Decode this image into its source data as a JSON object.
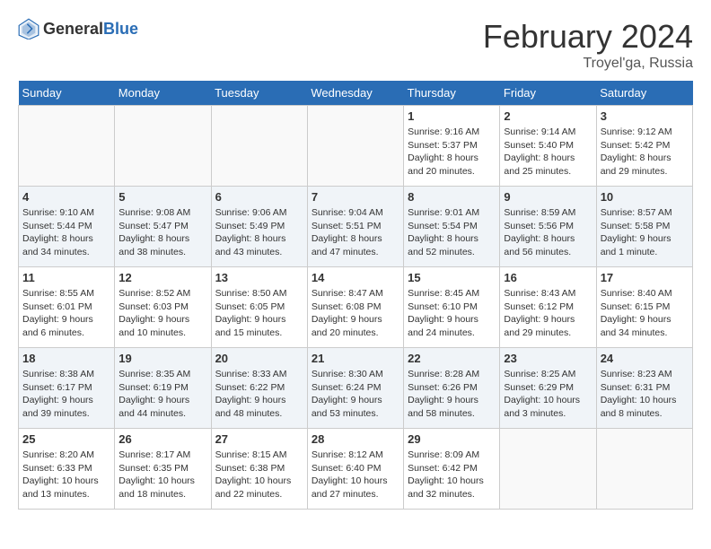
{
  "header": {
    "logo_general": "General",
    "logo_blue": "Blue",
    "month_year": "February 2024",
    "location": "Troyel'ga, Russia"
  },
  "weekdays": [
    "Sunday",
    "Monday",
    "Tuesday",
    "Wednesday",
    "Thursday",
    "Friday",
    "Saturday"
  ],
  "weeks": [
    {
      "shaded": false,
      "days": [
        {
          "num": "",
          "info": ""
        },
        {
          "num": "",
          "info": ""
        },
        {
          "num": "",
          "info": ""
        },
        {
          "num": "",
          "info": ""
        },
        {
          "num": "1",
          "info": "Sunrise: 9:16 AM\nSunset: 5:37 PM\nDaylight: 8 hours\nand 20 minutes."
        },
        {
          "num": "2",
          "info": "Sunrise: 9:14 AM\nSunset: 5:40 PM\nDaylight: 8 hours\nand 25 minutes."
        },
        {
          "num": "3",
          "info": "Sunrise: 9:12 AM\nSunset: 5:42 PM\nDaylight: 8 hours\nand 29 minutes."
        }
      ]
    },
    {
      "shaded": true,
      "days": [
        {
          "num": "4",
          "info": "Sunrise: 9:10 AM\nSunset: 5:44 PM\nDaylight: 8 hours\nand 34 minutes."
        },
        {
          "num": "5",
          "info": "Sunrise: 9:08 AM\nSunset: 5:47 PM\nDaylight: 8 hours\nand 38 minutes."
        },
        {
          "num": "6",
          "info": "Sunrise: 9:06 AM\nSunset: 5:49 PM\nDaylight: 8 hours\nand 43 minutes."
        },
        {
          "num": "7",
          "info": "Sunrise: 9:04 AM\nSunset: 5:51 PM\nDaylight: 8 hours\nand 47 minutes."
        },
        {
          "num": "8",
          "info": "Sunrise: 9:01 AM\nSunset: 5:54 PM\nDaylight: 8 hours\nand 52 minutes."
        },
        {
          "num": "9",
          "info": "Sunrise: 8:59 AM\nSunset: 5:56 PM\nDaylight: 8 hours\nand 56 minutes."
        },
        {
          "num": "10",
          "info": "Sunrise: 8:57 AM\nSunset: 5:58 PM\nDaylight: 9 hours\nand 1 minute."
        }
      ]
    },
    {
      "shaded": false,
      "days": [
        {
          "num": "11",
          "info": "Sunrise: 8:55 AM\nSunset: 6:01 PM\nDaylight: 9 hours\nand 6 minutes."
        },
        {
          "num": "12",
          "info": "Sunrise: 8:52 AM\nSunset: 6:03 PM\nDaylight: 9 hours\nand 10 minutes."
        },
        {
          "num": "13",
          "info": "Sunrise: 8:50 AM\nSunset: 6:05 PM\nDaylight: 9 hours\nand 15 minutes."
        },
        {
          "num": "14",
          "info": "Sunrise: 8:47 AM\nSunset: 6:08 PM\nDaylight: 9 hours\nand 20 minutes."
        },
        {
          "num": "15",
          "info": "Sunrise: 8:45 AM\nSunset: 6:10 PM\nDaylight: 9 hours\nand 24 minutes."
        },
        {
          "num": "16",
          "info": "Sunrise: 8:43 AM\nSunset: 6:12 PM\nDaylight: 9 hours\nand 29 minutes."
        },
        {
          "num": "17",
          "info": "Sunrise: 8:40 AM\nSunset: 6:15 PM\nDaylight: 9 hours\nand 34 minutes."
        }
      ]
    },
    {
      "shaded": true,
      "days": [
        {
          "num": "18",
          "info": "Sunrise: 8:38 AM\nSunset: 6:17 PM\nDaylight: 9 hours\nand 39 minutes."
        },
        {
          "num": "19",
          "info": "Sunrise: 8:35 AM\nSunset: 6:19 PM\nDaylight: 9 hours\nand 44 minutes."
        },
        {
          "num": "20",
          "info": "Sunrise: 8:33 AM\nSunset: 6:22 PM\nDaylight: 9 hours\nand 48 minutes."
        },
        {
          "num": "21",
          "info": "Sunrise: 8:30 AM\nSunset: 6:24 PM\nDaylight: 9 hours\nand 53 minutes."
        },
        {
          "num": "22",
          "info": "Sunrise: 8:28 AM\nSunset: 6:26 PM\nDaylight: 9 hours\nand 58 minutes."
        },
        {
          "num": "23",
          "info": "Sunrise: 8:25 AM\nSunset: 6:29 PM\nDaylight: 10 hours\nand 3 minutes."
        },
        {
          "num": "24",
          "info": "Sunrise: 8:23 AM\nSunset: 6:31 PM\nDaylight: 10 hours\nand 8 minutes."
        }
      ]
    },
    {
      "shaded": false,
      "days": [
        {
          "num": "25",
          "info": "Sunrise: 8:20 AM\nSunset: 6:33 PM\nDaylight: 10 hours\nand 13 minutes."
        },
        {
          "num": "26",
          "info": "Sunrise: 8:17 AM\nSunset: 6:35 PM\nDaylight: 10 hours\nand 18 minutes."
        },
        {
          "num": "27",
          "info": "Sunrise: 8:15 AM\nSunset: 6:38 PM\nDaylight: 10 hours\nand 22 minutes."
        },
        {
          "num": "28",
          "info": "Sunrise: 8:12 AM\nSunset: 6:40 PM\nDaylight: 10 hours\nand 27 minutes."
        },
        {
          "num": "29",
          "info": "Sunrise: 8:09 AM\nSunset: 6:42 PM\nDaylight: 10 hours\nand 32 minutes."
        },
        {
          "num": "",
          "info": ""
        },
        {
          "num": "",
          "info": ""
        }
      ]
    }
  ]
}
